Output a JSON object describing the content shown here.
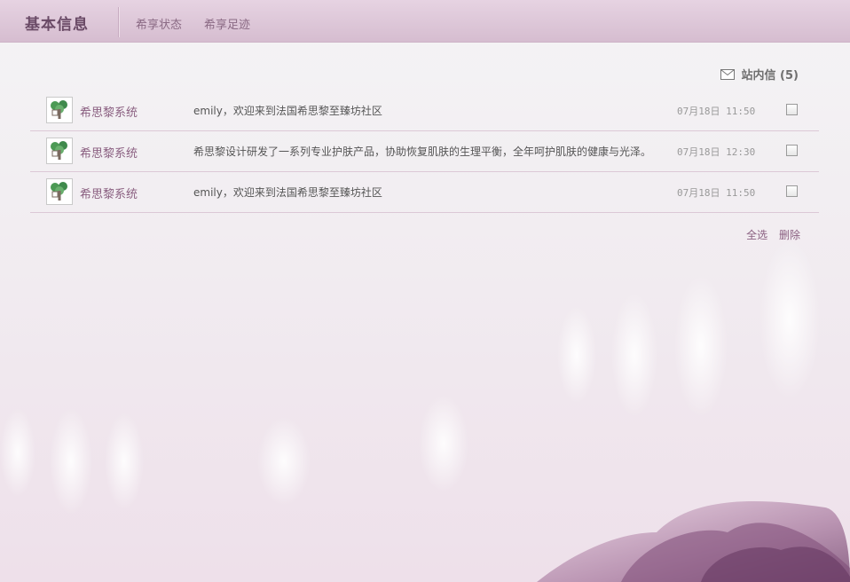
{
  "header": {
    "title": "基本信息",
    "tabs": [
      {
        "label": "希享状态"
      },
      {
        "label": "希享足迹"
      }
    ]
  },
  "inbox": {
    "label": "站内信 (5)"
  },
  "messages": [
    {
      "sender": "希思黎系统",
      "content": "emily，欢迎来到法国希思黎至臻坊社区",
      "time": "07月18日 11:50"
    },
    {
      "sender": "希思黎系统",
      "content": "希思黎设计研发了一系列专业护肤产品，协助恢复肌肤的生理平衡，全年呵护肌肤的健康与光泽。",
      "time": "07月18日 12:30"
    },
    {
      "sender": "希思黎系统",
      "content": "emily，欢迎来到法国希思黎至臻坊社区",
      "time": "07月18日 11:50"
    }
  ],
  "actions": {
    "select_all": "全选",
    "delete": "删除"
  },
  "colors": {
    "header_bg": "#dcc4d7",
    "accent": "#8a5f80",
    "row_border": "#dcc8d6"
  }
}
